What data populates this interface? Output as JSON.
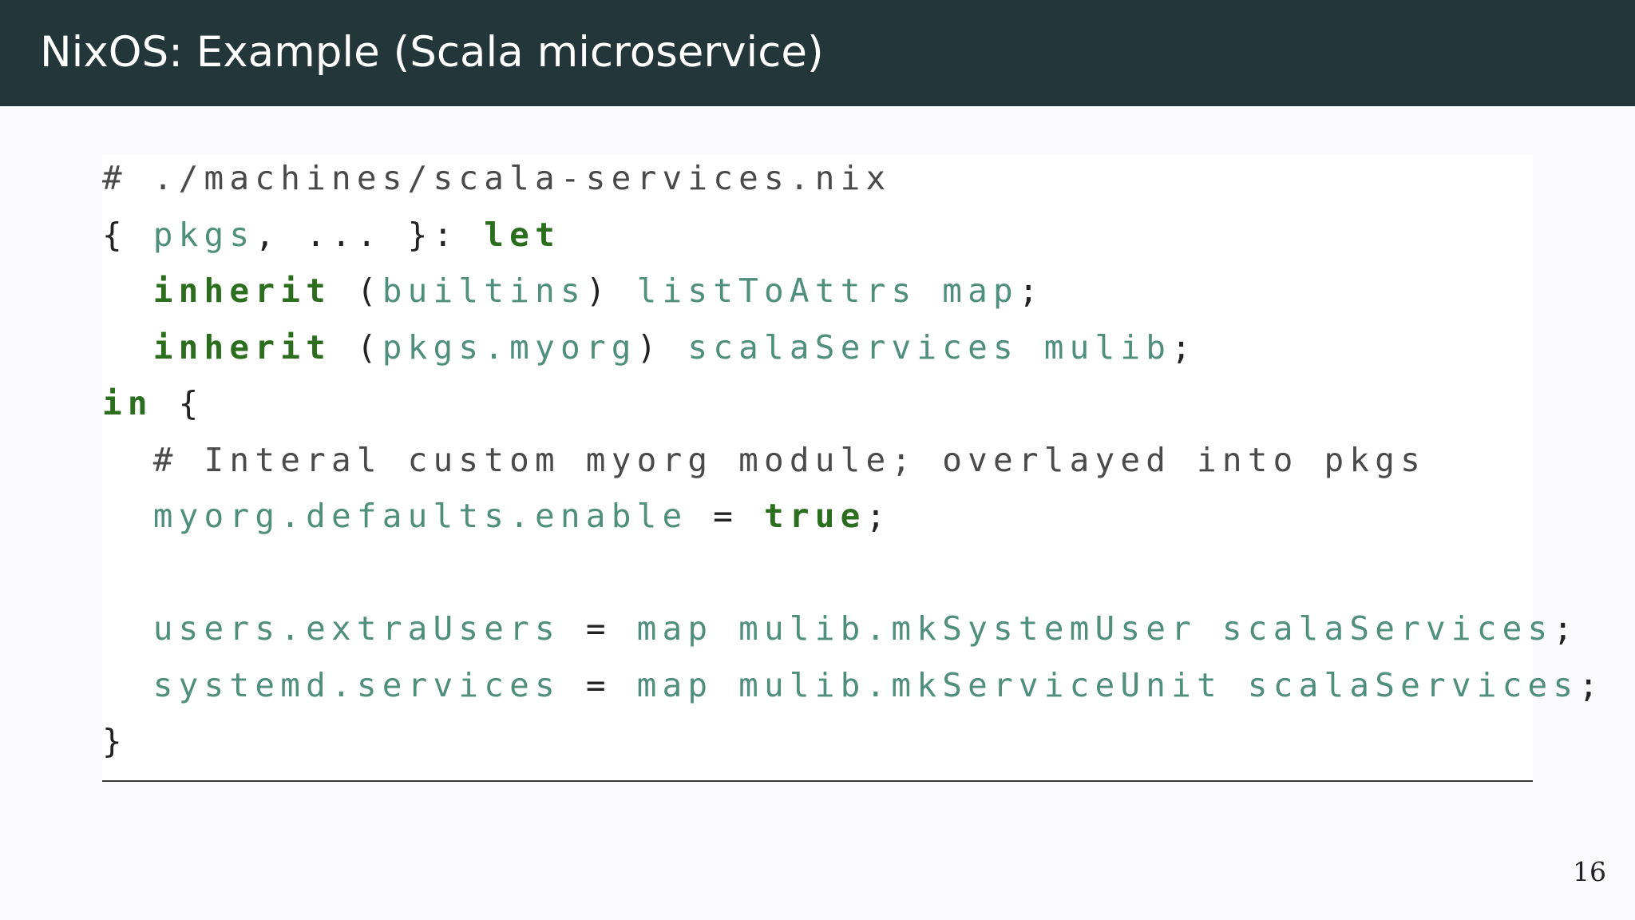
{
  "slide": {
    "title": "NixOS: Example (Scala microservice)",
    "page_number": "16"
  },
  "code": {
    "lines": [
      {
        "tokens": [
          {
            "text": "# ./machines/scala-services.nix",
            "kind": "comment"
          }
        ]
      },
      {
        "tokens": [
          {
            "text": "{ ",
            "kind": "plain"
          },
          {
            "text": "pkgs",
            "kind": "ident"
          },
          {
            "text": ", ... }: ",
            "kind": "plain"
          },
          {
            "text": "let",
            "kind": "keyword"
          }
        ]
      },
      {
        "tokens": [
          {
            "text": "  ",
            "kind": "plain"
          },
          {
            "text": "inherit",
            "kind": "keyword"
          },
          {
            "text": " (",
            "kind": "plain"
          },
          {
            "text": "builtins",
            "kind": "ident"
          },
          {
            "text": ") ",
            "kind": "plain"
          },
          {
            "text": "listToAttrs map",
            "kind": "ident"
          },
          {
            "text": ";",
            "kind": "plain"
          }
        ]
      },
      {
        "tokens": [
          {
            "text": "  ",
            "kind": "plain"
          },
          {
            "text": "inherit",
            "kind": "keyword"
          },
          {
            "text": " (",
            "kind": "plain"
          },
          {
            "text": "pkgs.myorg",
            "kind": "ident"
          },
          {
            "text": ") ",
            "kind": "plain"
          },
          {
            "text": "scalaServices mulib",
            "kind": "ident"
          },
          {
            "text": ";",
            "kind": "plain"
          }
        ]
      },
      {
        "tokens": [
          {
            "text": "in",
            "kind": "keyword"
          },
          {
            "text": " {",
            "kind": "plain"
          }
        ]
      },
      {
        "tokens": [
          {
            "text": "  ",
            "kind": "plain"
          },
          {
            "text": "# Interal custom myorg module; overlayed into pkgs",
            "kind": "comment"
          }
        ]
      },
      {
        "tokens": [
          {
            "text": "  ",
            "kind": "plain"
          },
          {
            "text": "myorg.defaults.enable",
            "kind": "ident"
          },
          {
            "text": " = ",
            "kind": "plain"
          },
          {
            "text": "true",
            "kind": "keyword"
          },
          {
            "text": ";",
            "kind": "plain"
          }
        ]
      },
      {
        "tokens": []
      },
      {
        "tokens": [
          {
            "text": "  ",
            "kind": "plain"
          },
          {
            "text": "users.extraUsers",
            "kind": "ident"
          },
          {
            "text": " = ",
            "kind": "plain"
          },
          {
            "text": "map mulib.mkSystemUser scalaServices",
            "kind": "ident"
          },
          {
            "text": ";",
            "kind": "plain"
          }
        ]
      },
      {
        "tokens": [
          {
            "text": "  ",
            "kind": "plain"
          },
          {
            "text": "systemd.services",
            "kind": "ident"
          },
          {
            "text": " = ",
            "kind": "plain"
          },
          {
            "text": "map mulib.mkServiceUnit scalaServices",
            "kind": "ident"
          },
          {
            "text": ";",
            "kind": "plain"
          }
        ]
      },
      {
        "tokens": [
          {
            "text": "}",
            "kind": "plain"
          }
        ]
      }
    ]
  }
}
